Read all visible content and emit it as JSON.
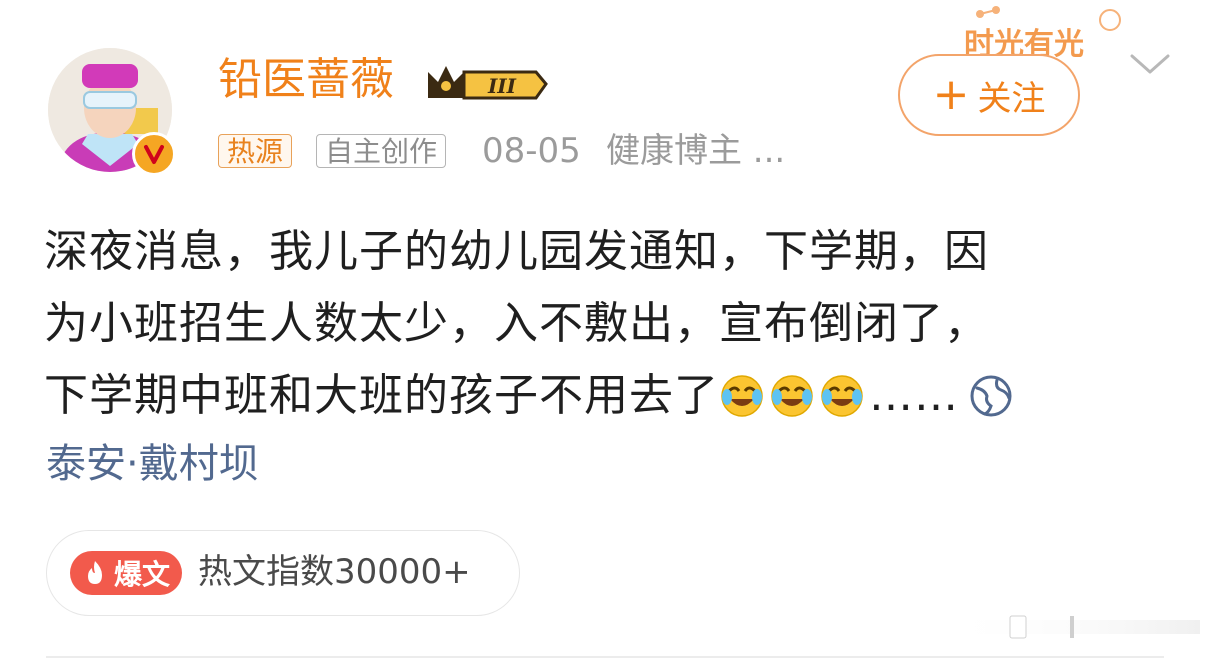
{
  "watermark": {
    "text": "时光有光"
  },
  "author": {
    "name": "铅医蔷薇",
    "level_badge": "III",
    "avatar_icon": "doctor-avatar-icon",
    "verified_icon": "verified-v-icon"
  },
  "meta": {
    "tag_hot": "热源",
    "tag_original": "自主创作",
    "date": "08-05",
    "category": "健康博主 ..."
  },
  "follow_button": {
    "label": "关注",
    "icon": "plus-icon"
  },
  "post": {
    "line1": "深夜消息，我儿子的幼儿园发通知，下学期，因",
    "line2": "为小班招生人数太少，入不敷出，宣布倒闭了，",
    "line3": "下学期中班和大班的孩子不用去了",
    "line3_tail": "……",
    "emoji": [
      "laughing-crying-emoji",
      "laughing-crying-emoji",
      "laughing-crying-emoji"
    ],
    "location": "泰安·戴村坝"
  },
  "hot_index": {
    "badge": "爆文",
    "text": "热文指数30000+"
  },
  "colors": {
    "accent": "#f0811a",
    "link": "#52698f",
    "hot_red": "#f25a4c"
  }
}
